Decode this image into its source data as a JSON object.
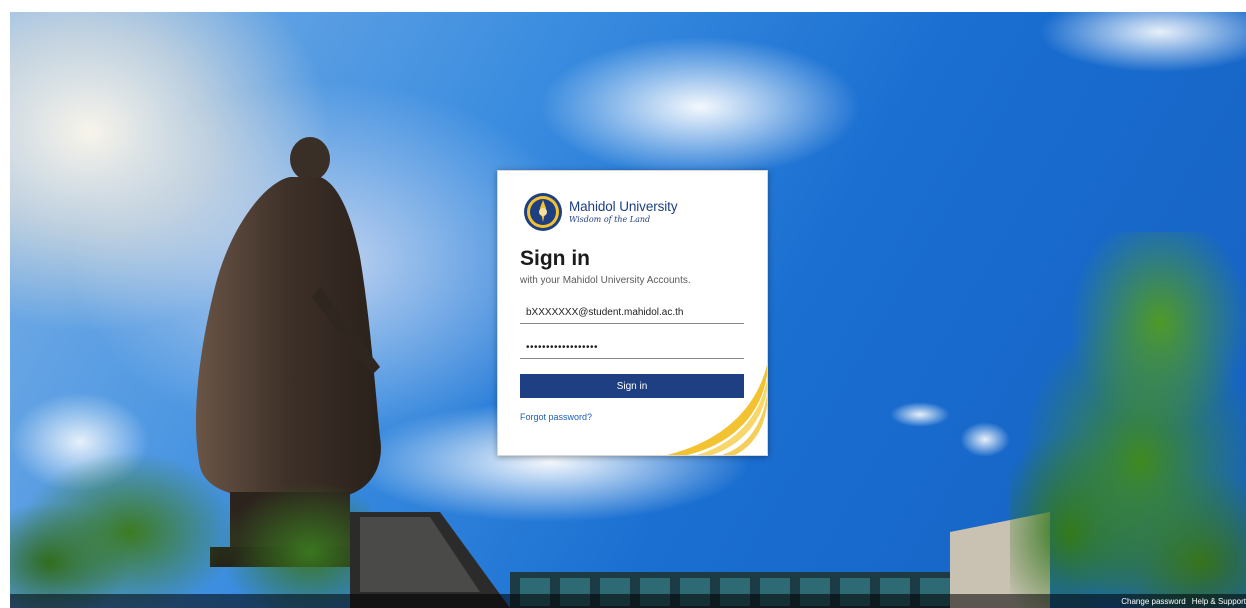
{
  "login_card": {
    "logo": {
      "name": "Mahidol University",
      "tagline": "Wisdom of the Land"
    },
    "heading": "Sign in",
    "subheading": "with your Mahidol University Accounts.",
    "username_value": "bXXXXXXX@student.mahidol.ac.th",
    "password_value": "••••••••••••••••••",
    "sign_in_label": "Sign in",
    "forgot_password_label": "Forgot password?"
  },
  "footer": {
    "change_password": "Change password",
    "help_support": "Help & Support"
  },
  "colors": {
    "brand_navy": "#1f3f83",
    "link_blue": "#1a5fb4",
    "swoosh_gold": "#f2c230"
  },
  "icons": {
    "logo": "university-seal-icon"
  }
}
